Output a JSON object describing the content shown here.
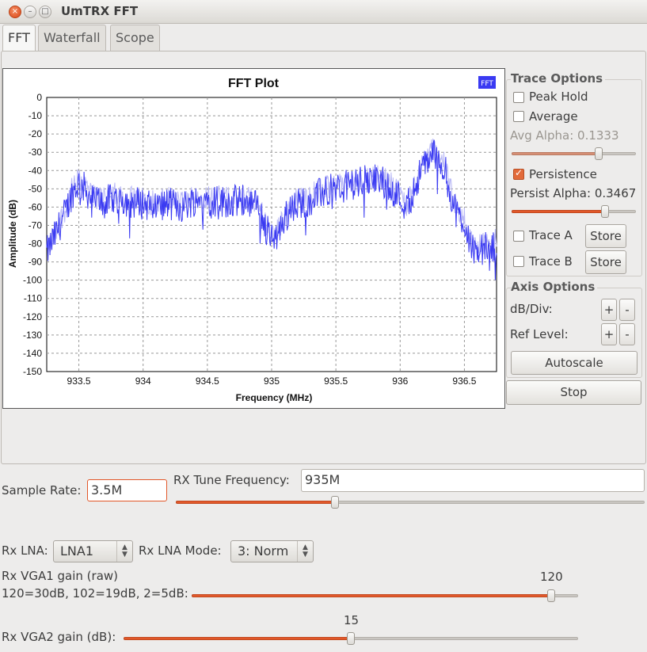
{
  "window": {
    "title": "UmTRX FFT",
    "close_icon": "×",
    "min_icon": "–",
    "max_icon": "□"
  },
  "tabs": [
    {
      "label": "FFT"
    },
    {
      "label": "Waterfall"
    },
    {
      "label": "Scope"
    }
  ],
  "chart_data": {
    "type": "line",
    "title": "FFT Plot",
    "xlabel": "Frequency (MHz)",
    "ylabel": "Amplitude (dB)",
    "xlim": [
      933.25,
      936.75
    ],
    "ylim": [
      -150,
      0
    ],
    "xticks": [
      933.5,
      934,
      934.5,
      935,
      935.5,
      936,
      936.5
    ],
    "xtick_labels": [
      "933.5",
      "934",
      "934.5",
      "935",
      "935.5",
      "936",
      "936.5"
    ],
    "yticks": [
      0,
      -10,
      -20,
      -30,
      -40,
      -50,
      -60,
      -70,
      -80,
      -90,
      -100,
      -110,
      -120,
      -130,
      -140,
      -150
    ],
    "ytick_labels": [
      "0",
      "-10",
      "-20",
      "-30",
      "-40",
      "-50",
      "-60",
      "-70",
      "-80",
      "-90",
      "-100",
      "-110",
      "-120",
      "-130",
      "-140",
      "-150"
    ],
    "grid": true,
    "legend": {
      "label": "FFT",
      "color": "#3a3af2",
      "position": "top-right"
    },
    "series": [
      {
        "color": "#3a3af2",
        "x": [
          933.25,
          933.3,
          933.35,
          933.4,
          933.45,
          933.5,
          933.55,
          933.6,
          933.7,
          933.8,
          933.9,
          934.0,
          934.1,
          934.2,
          934.3,
          934.4,
          934.5,
          934.6,
          934.7,
          934.8,
          934.9,
          934.95,
          935.0,
          935.05,
          935.1,
          935.2,
          935.3,
          935.4,
          935.5,
          935.6,
          935.7,
          935.8,
          935.9,
          936.0,
          936.05,
          936.1,
          936.15,
          936.2,
          936.25,
          936.3,
          936.35,
          936.4,
          936.45,
          936.5,
          936.55,
          936.6,
          936.65,
          936.7,
          936.75
        ],
        "y": [
          -85,
          -78,
          -70,
          -62,
          -52,
          -47,
          -50,
          -56,
          -57,
          -55,
          -57,
          -58,
          -60,
          -58,
          -60,
          -56,
          -56,
          -57,
          -57,
          -56,
          -60,
          -70,
          -78,
          -75,
          -66,
          -58,
          -56,
          -52,
          -50,
          -48,
          -46,
          -45,
          -47,
          -55,
          -60,
          -52,
          -42,
          -36,
          -30,
          -33,
          -40,
          -55,
          -65,
          -68,
          -80,
          -85,
          -82,
          -84,
          -80
        ]
      }
    ]
  },
  "trace_options": {
    "title": "Trace Options",
    "peak_hold": "Peak Hold",
    "average": "Average",
    "avg_alpha": "Avg Alpha: 0.1333",
    "avg_alpha_value": 0.1333,
    "persistence": "Persistence",
    "persist_alpha": "Persist Alpha: 0.3467",
    "persist_alpha_value": 0.3467,
    "trace_a": "Trace A",
    "trace_b": "Trace B",
    "store": "Store"
  },
  "axis_options": {
    "title": "Axis Options",
    "db_div": "dB/Div:",
    "ref_level": "Ref Level:",
    "plus": "+",
    "minus": "-",
    "autoscale": "Autoscale"
  },
  "stop": "Stop",
  "controls": {
    "sample_rate_label": "Sample Rate:",
    "sample_rate_value": "3.5M",
    "rx_tune_label": "RX Tune Frequency:",
    "rx_tune_value": "935M",
    "rx_tune_slider": 0.34,
    "rx_lna_label": "Rx LNA:",
    "rx_lna_value": "LNA1",
    "rx_lna_mode_label": "Rx LNA Mode:",
    "rx_lna_mode_value": "3: Norm",
    "vga1_label": "Rx VGA1 gain (raw)",
    "vga1_sublabel": "120=30dB, 102=19dB, 2=5dB:",
    "vga1_value": "120",
    "vga1_slider": 0.93,
    "vga2_label": "Rx VGA2 gain (dB):",
    "vga2_value": "15",
    "vga2_slider": 0.5
  }
}
